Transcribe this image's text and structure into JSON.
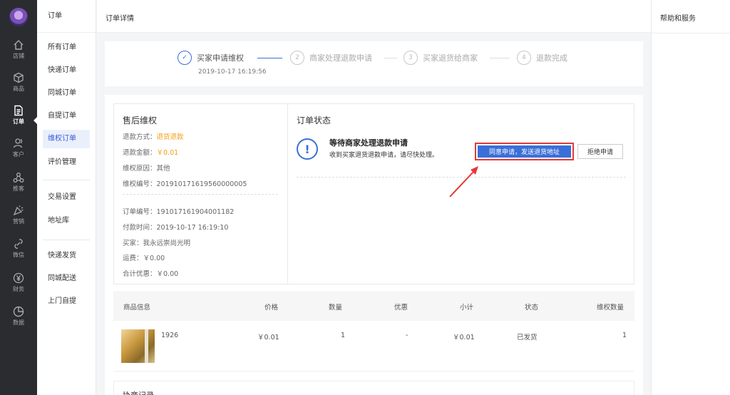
{
  "rail": {
    "items": [
      {
        "label": "店铺",
        "icon": "home-icon"
      },
      {
        "label": "商品",
        "icon": "cube-icon"
      },
      {
        "label": "订单",
        "icon": "document-icon",
        "active": true
      },
      {
        "label": "客户",
        "icon": "users-icon"
      },
      {
        "label": "推客",
        "icon": "share-icon"
      },
      {
        "label": "营销",
        "icon": "megaphone-icon"
      },
      {
        "label": "微信",
        "icon": "link-icon"
      },
      {
        "label": "财务",
        "icon": "yen-icon"
      },
      {
        "label": "数据",
        "icon": "chart-icon"
      }
    ]
  },
  "subnav": {
    "title": "订单",
    "items": [
      "所有订单",
      "快递订单",
      "同城订单",
      "自提订单",
      "维权订单",
      "评价管理",
      "交易设置",
      "地址库",
      "快递发货",
      "同城配送",
      "上门自提"
    ],
    "active": "维权订单"
  },
  "topbar": {
    "title": "订单详情"
  },
  "rightpanel": {
    "title": "帮助和服务"
  },
  "steps": {
    "items": [
      {
        "num": "✓",
        "label": "买家申请维权",
        "done": true
      },
      {
        "num": "2",
        "label": "商家处理退款申请"
      },
      {
        "num": "3",
        "label": "买家退货给商家"
      },
      {
        "num": "4",
        "label": "退款完成"
      }
    ],
    "time": "2019-10-17 16:19:56"
  },
  "after_sale": {
    "title": "售后维权",
    "refund_method_label": "退款方式：",
    "refund_method": "退货退款",
    "refund_amount_label": "退款金额：",
    "refund_amount": "￥0.01",
    "reason": "维权原因：其他",
    "case_no": "维权编号：201910171619560000005",
    "order_no": "订单编号：191017161904001182",
    "pay_time": "付款时间：2019-10-17 16:19:10",
    "buyer": "买家：我永远崇尚光明",
    "shipping": "运费：￥0.00",
    "discount": "合计优惠：￥0.00"
  },
  "order_status": {
    "title": "订单状态",
    "headline": "等待商家处理退款申请",
    "sub": "收到买家退货退款申请，请尽快处理。",
    "agree_button": "同意申请，发送退货地址",
    "refuse_button": "拒绝申请"
  },
  "table": {
    "headers": [
      "商品信息",
      "价格",
      "数量",
      "优惠",
      "小计",
      "状态",
      "维权数量"
    ],
    "rows": [
      {
        "name": "1926",
        "price": "￥0.01",
        "qty": "1",
        "discount": "-",
        "subtotal": "￥0.01",
        "status": "已发货",
        "claim_qty": "1"
      }
    ]
  },
  "log": {
    "title": "协商记录"
  },
  "colors": {
    "primary": "#3b6fd8",
    "highlight_border": "#e53935",
    "orange": "#f39c12"
  }
}
